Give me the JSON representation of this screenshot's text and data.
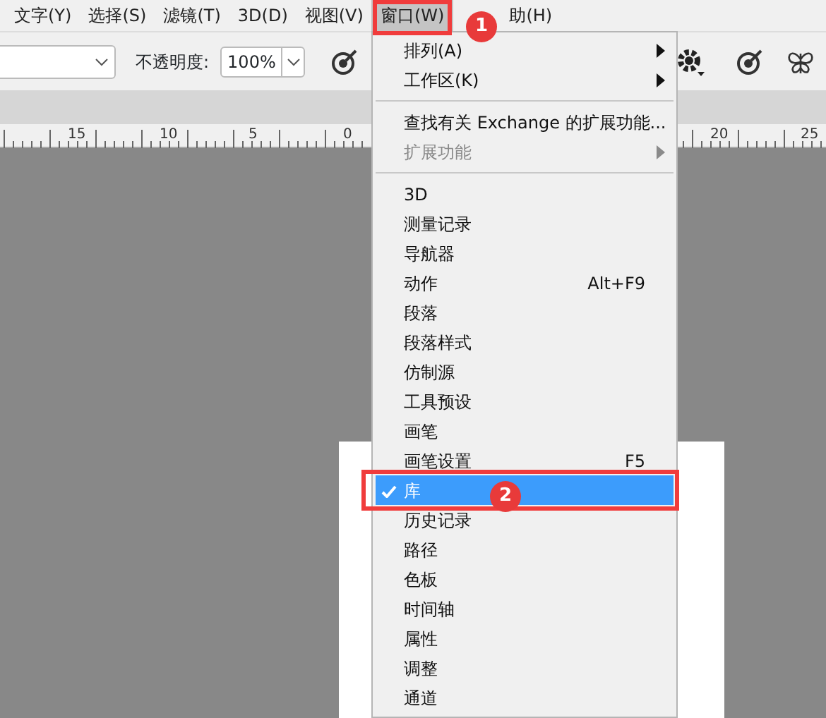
{
  "menubar": [
    {
      "label": "文字(Y)",
      "selected": false
    },
    {
      "label": "选择(S)",
      "selected": false
    },
    {
      "label": "滤镜(T)",
      "selected": false
    },
    {
      "label": "3D(D)",
      "selected": false
    },
    {
      "label": "视图(V)",
      "selected": false
    },
    {
      "label": "窗口(W)",
      "selected": true
    },
    {
      "label": "助(H)",
      "selected": false
    }
  ],
  "options_bar": {
    "opacity_label": "不透明度:",
    "opacity_value": "100%"
  },
  "ruler": [
    {
      "label": "15"
    },
    {
      "label": "10"
    },
    {
      "label": "5"
    },
    {
      "label": "0"
    },
    {
      "label": "20"
    },
    {
      "label": "25"
    }
  ],
  "menu": [
    {
      "kind": "item",
      "label": "排列(A)",
      "submenu": true,
      "disabled": false,
      "checked": false,
      "selected": false
    },
    {
      "kind": "item",
      "label": "工作区(K)",
      "submenu": true,
      "disabled": false,
      "checked": false,
      "selected": false
    },
    {
      "kind": "separator"
    },
    {
      "kind": "item",
      "label": "查找有关 Exchange 的扩展功能...",
      "submenu": false,
      "disabled": false,
      "checked": false,
      "selected": false
    },
    {
      "kind": "item",
      "label": "扩展功能",
      "submenu": true,
      "disabled": true,
      "checked": false,
      "selected": false
    },
    {
      "kind": "separator"
    },
    {
      "kind": "item",
      "label": "3D",
      "submenu": false,
      "disabled": false,
      "checked": false,
      "selected": false
    },
    {
      "kind": "item",
      "label": "测量记录",
      "submenu": false,
      "disabled": false,
      "checked": false,
      "selected": false
    },
    {
      "kind": "item",
      "label": "导航器",
      "submenu": false,
      "disabled": false,
      "checked": false,
      "selected": false
    },
    {
      "kind": "item",
      "label": "动作",
      "shortcut": "Alt+F9",
      "submenu": false,
      "disabled": false,
      "checked": false,
      "selected": false
    },
    {
      "kind": "item",
      "label": "段落",
      "submenu": false,
      "disabled": false,
      "checked": false,
      "selected": false
    },
    {
      "kind": "item",
      "label": "段落样式",
      "submenu": false,
      "disabled": false,
      "checked": false,
      "selected": false
    },
    {
      "kind": "item",
      "label": "仿制源",
      "submenu": false,
      "disabled": false,
      "checked": false,
      "selected": false
    },
    {
      "kind": "item",
      "label": "工具预设",
      "submenu": false,
      "disabled": false,
      "checked": false,
      "selected": false
    },
    {
      "kind": "item",
      "label": "画笔",
      "submenu": false,
      "disabled": false,
      "checked": false,
      "selected": false
    },
    {
      "kind": "item",
      "label": "画笔设置",
      "shortcut": "F5",
      "submenu": false,
      "disabled": false,
      "checked": false,
      "selected": false
    },
    {
      "kind": "item",
      "label": "库",
      "submenu": false,
      "disabled": false,
      "checked": true,
      "selected": true
    },
    {
      "kind": "item",
      "label": "历史记录",
      "submenu": false,
      "disabled": false,
      "checked": false,
      "selected": false
    },
    {
      "kind": "item",
      "label": "路径",
      "submenu": false,
      "disabled": false,
      "checked": false,
      "selected": false
    },
    {
      "kind": "item",
      "label": "色板",
      "submenu": false,
      "disabled": false,
      "checked": false,
      "selected": false
    },
    {
      "kind": "item",
      "label": "时间轴",
      "submenu": false,
      "disabled": false,
      "checked": false,
      "selected": false
    },
    {
      "kind": "item",
      "label": "属性",
      "submenu": false,
      "disabled": false,
      "checked": false,
      "selected": false
    },
    {
      "kind": "item",
      "label": "调整",
      "submenu": false,
      "disabled": false,
      "checked": false,
      "selected": false
    },
    {
      "kind": "item",
      "label": "通道",
      "submenu": false,
      "disabled": false,
      "checked": false,
      "selected": false
    }
  ],
  "annotations": [
    {
      "label": "1"
    },
    {
      "label": "2"
    }
  ]
}
